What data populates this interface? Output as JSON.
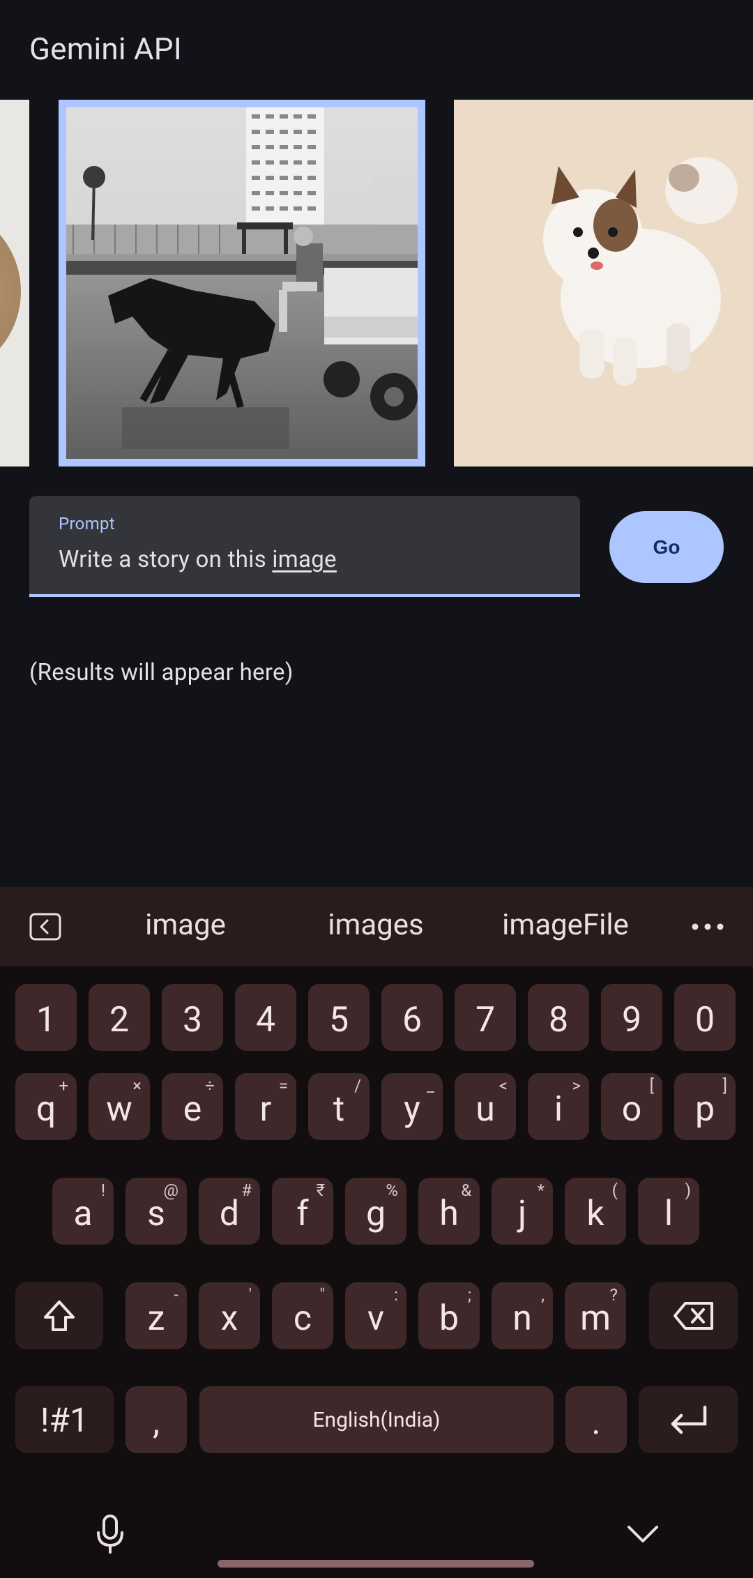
{
  "app": {
    "title": "Gemini API"
  },
  "prompt": {
    "label": "Prompt",
    "value_prefix": "Write a story on this ",
    "value_underlined": "image"
  },
  "go_button": {
    "label": "Go"
  },
  "results": {
    "text": "(Results will appear here)"
  },
  "keyboard": {
    "suggestions": [
      "image",
      "images",
      "imageFile"
    ],
    "row_numbers": [
      "1",
      "2",
      "3",
      "4",
      "5",
      "6",
      "7",
      "8",
      "9",
      "0"
    ],
    "row_q": [
      {
        "k": "q",
        "s": "+"
      },
      {
        "k": "w",
        "s": "×"
      },
      {
        "k": "e",
        "s": "÷"
      },
      {
        "k": "r",
        "s": "="
      },
      {
        "k": "t",
        "s": "/"
      },
      {
        "k": "y",
        "s": "_"
      },
      {
        "k": "u",
        "s": "<"
      },
      {
        "k": "i",
        "s": ">"
      },
      {
        "k": "o",
        "s": "["
      },
      {
        "k": "p",
        "s": "]"
      }
    ],
    "row_a": [
      {
        "k": "a",
        "s": "!"
      },
      {
        "k": "s",
        "s": "@"
      },
      {
        "k": "d",
        "s": "#"
      },
      {
        "k": "f",
        "s": "₹"
      },
      {
        "k": "g",
        "s": "%"
      },
      {
        "k": "h",
        "s": "&"
      },
      {
        "k": "j",
        "s": "*"
      },
      {
        "k": "k",
        "s": "("
      },
      {
        "k": "l",
        "s": ")"
      }
    ],
    "row_z": [
      {
        "k": "z",
        "s": "-"
      },
      {
        "k": "x",
        "s": "'"
      },
      {
        "k": "c",
        "s": "\""
      },
      {
        "k": "v",
        "s": ":"
      },
      {
        "k": "b",
        "s": ";"
      },
      {
        "k": "n",
        "s": ","
      },
      {
        "k": "m",
        "s": "?"
      }
    ],
    "symbols_key": "!#1",
    "comma_key": ",",
    "space_label": "English(India)",
    "period_key": "."
  },
  "colors": {
    "background": "#111318",
    "accent": "#aec6ff",
    "key": "#3e2829",
    "keyboard_bg": "#120d0e"
  }
}
